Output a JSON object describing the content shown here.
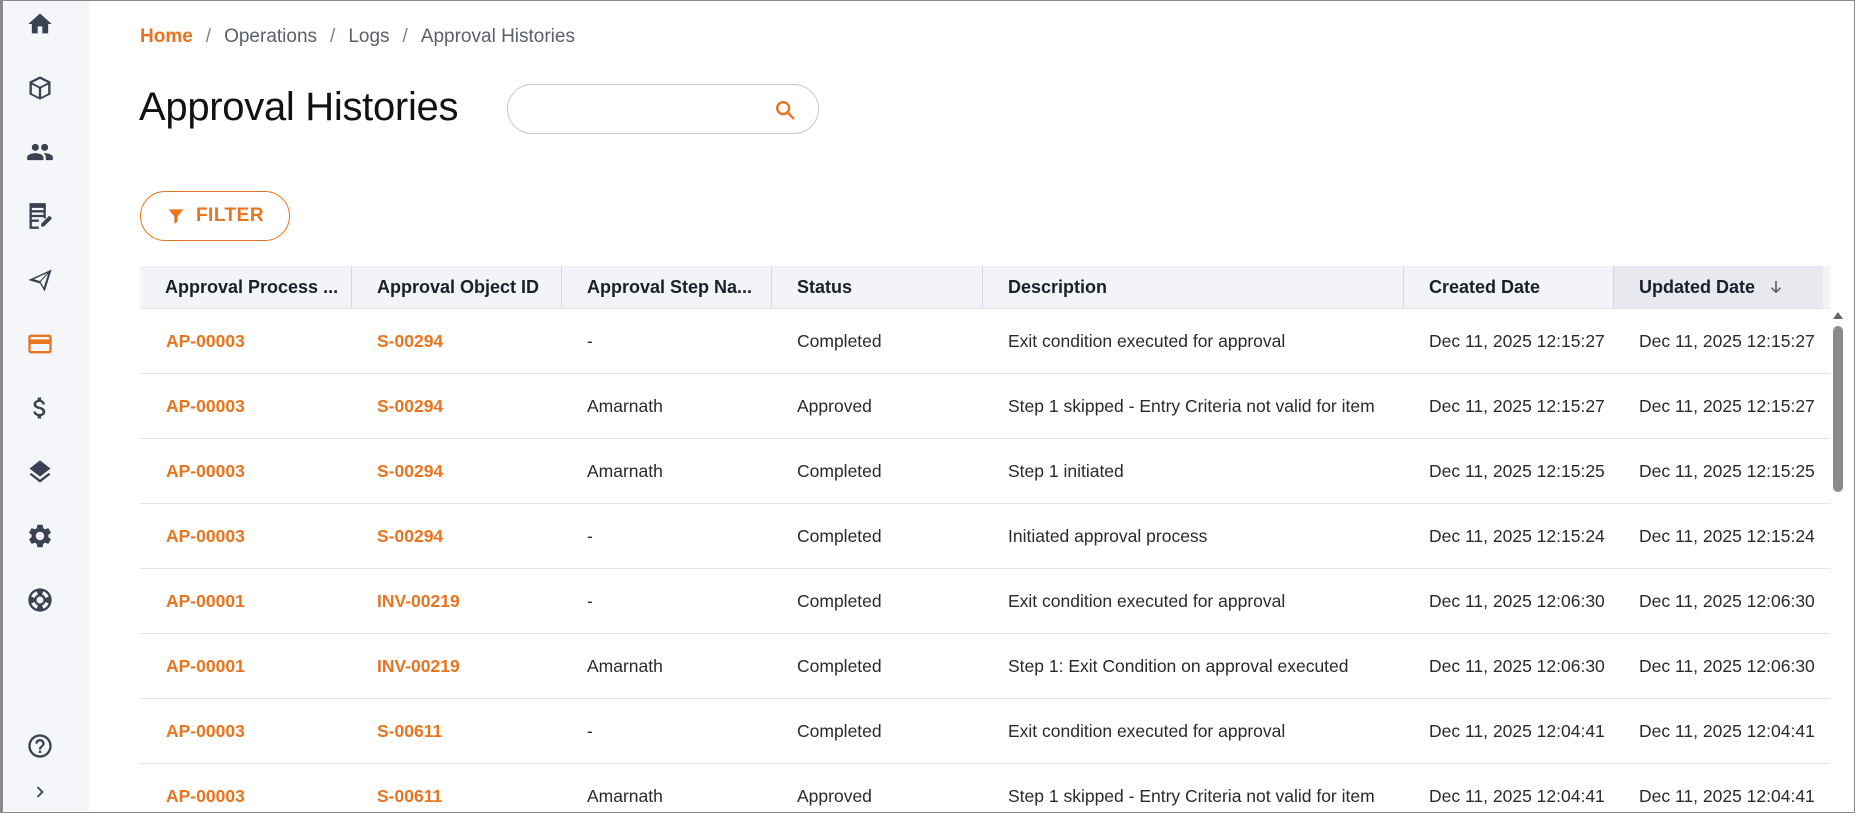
{
  "breadcrumb": {
    "home": "Home",
    "items": [
      "Operations",
      "Logs",
      "Approval Histories"
    ],
    "separator": "/"
  },
  "page": {
    "title": "Approval Histories"
  },
  "search": {
    "placeholder": "",
    "value": ""
  },
  "filter": {
    "label": "FILTER"
  },
  "colors": {
    "accent": "#e8741f",
    "sidebar_bg": "#f5f6fa",
    "header_bg": "#f3f4f8"
  },
  "sidebar": {
    "items": [
      {
        "icon": "home-icon",
        "active": false
      },
      {
        "icon": "cube-icon",
        "active": false
      },
      {
        "icon": "people-icon",
        "active": false
      },
      {
        "icon": "document-edit-icon",
        "active": false
      },
      {
        "icon": "send-icon",
        "active": false
      },
      {
        "icon": "credit-card-icon",
        "active": true
      },
      {
        "icon": "dollar-icon",
        "active": false
      },
      {
        "icon": "layers-icon",
        "active": false
      },
      {
        "icon": "gear-icon",
        "active": false
      },
      {
        "icon": "lifebuoy-icon",
        "active": false
      }
    ],
    "bottom": [
      {
        "icon": "help-icon"
      },
      {
        "icon": "chevron-right-icon"
      }
    ]
  },
  "table": {
    "columns": [
      "Approval Process ...",
      "Approval Object ID",
      "Approval Step Na...",
      "Status",
      "Description",
      "Created Date",
      "Updated Date"
    ],
    "sorted_column": "Updated Date",
    "sort_direction": "desc",
    "rows": [
      [
        "AP-00003",
        "S-00294",
        "-",
        "Completed",
        "Exit condition executed for approval",
        "Dec 11, 2025 12:15:27",
        "Dec 11, 2025 12:15:27"
      ],
      [
        "AP-00003",
        "S-00294",
        "Amarnath",
        "Approved",
        "Step 1 skipped - Entry Criteria not valid for item",
        "Dec 11, 2025 12:15:27",
        "Dec 11, 2025 12:15:27"
      ],
      [
        "AP-00003",
        "S-00294",
        "Amarnath",
        "Completed",
        "Step 1 initiated",
        "Dec 11, 2025 12:15:25",
        "Dec 11, 2025 12:15:25"
      ],
      [
        "AP-00003",
        "S-00294",
        "-",
        "Completed",
        "Initiated approval process",
        "Dec 11, 2025 12:15:24",
        "Dec 11, 2025 12:15:24"
      ],
      [
        "AP-00001",
        "INV-00219",
        "-",
        "Completed",
        "Exit condition executed for approval",
        "Dec 11, 2025 12:06:30",
        "Dec 11, 2025 12:06:30"
      ],
      [
        "AP-00001",
        "INV-00219",
        "Amarnath",
        "Completed",
        "Step 1: Exit Condition on approval executed",
        "Dec 11, 2025 12:06:30",
        "Dec 11, 2025 12:06:30"
      ],
      [
        "AP-00003",
        "S-00611",
        "-",
        "Completed",
        "Exit condition executed for approval",
        "Dec 11, 2025 12:04:41",
        "Dec 11, 2025 12:04:41"
      ],
      [
        "AP-00003",
        "S-00611",
        "Amarnath",
        "Approved",
        "Step 1 skipped - Entry Criteria not valid for item",
        "Dec 11, 2025 12:04:41",
        "Dec 11, 2025 12:04:41"
      ]
    ]
  }
}
